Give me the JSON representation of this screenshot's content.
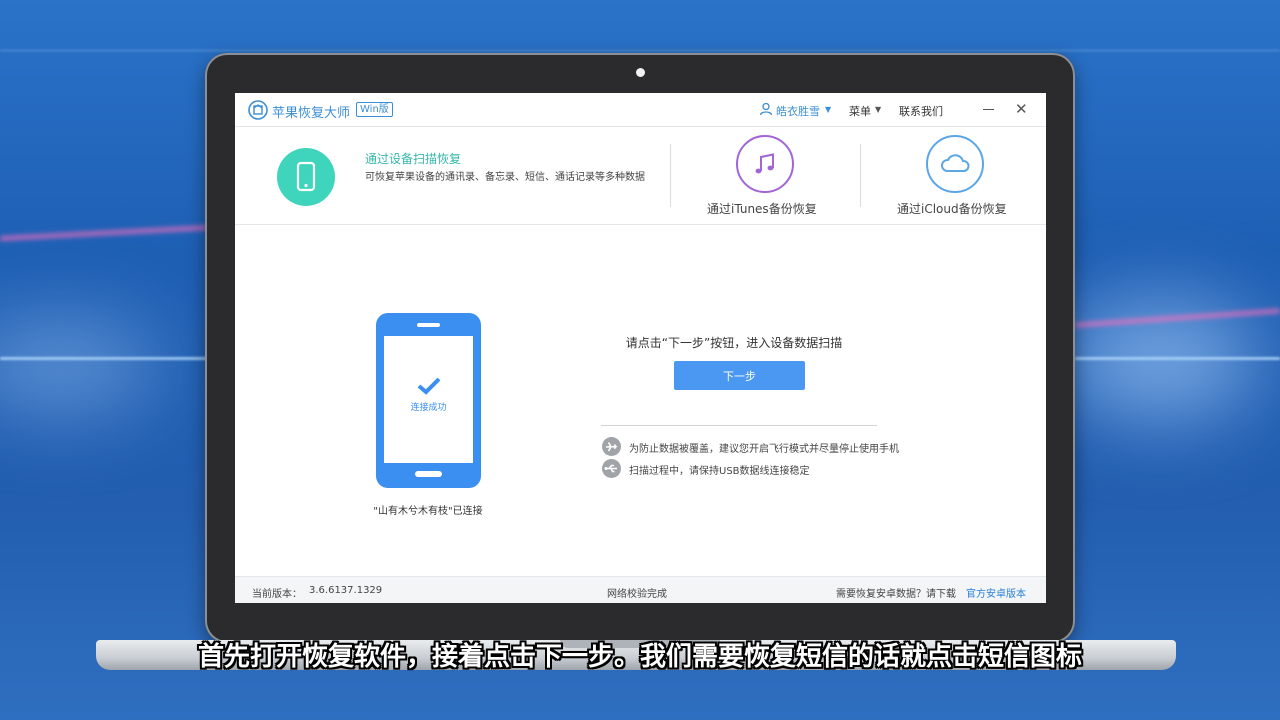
{
  "app": {
    "name": "苹果恢复大师",
    "edition": "Win版",
    "user": "皓衣胜雪",
    "menu": "菜单",
    "contact": "联系我们"
  },
  "modes": {
    "scan": {
      "title": "通过设备扫描恢复",
      "desc": "可恢复苹果设备的通讯录、备忘录、短信、通话记录等多种数据"
    },
    "itunes": {
      "label": "通过iTunes备份恢复"
    },
    "icloud": {
      "label": "通过iCloud备份恢复"
    }
  },
  "device": {
    "status": "连接成功",
    "connected_text": "\"山有木兮木有枝\"已连接"
  },
  "main": {
    "instruction": "请点击“下一步”按钮，进入设备数据扫描",
    "next_button": "下一步",
    "tips": [
      "为防止数据被覆盖，建议您开启飞行模式并尽量停止使用手机",
      "扫描过程中，请保持USB数据线连接稳定"
    ]
  },
  "statusbar": {
    "version_label": "当前版本：",
    "version": "3.6.6137.1329",
    "network": "网络校验完成",
    "android_prompt": "需要恢复安卓数据？请下载",
    "android_link": "官方安卓版本"
  },
  "subtitle": "首先打开恢复软件，接着点击下一步。我们需要恢复短信的话就点击短信图标",
  "colors": {
    "accent": "#3c8fd6",
    "teal": "#3fd5bd",
    "itunes": "#a266d6",
    "icloud": "#5ba6e6",
    "button": "#4a98f1"
  }
}
